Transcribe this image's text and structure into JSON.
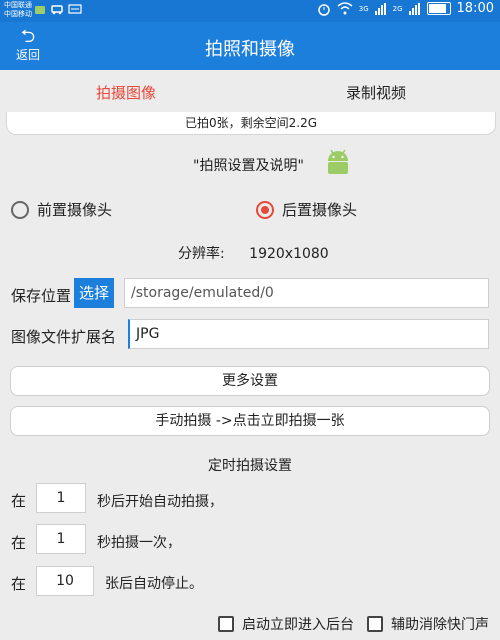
{
  "status_bar": {
    "carrier1": "中国联通",
    "carrier2": "中国移动",
    "time": "18:00",
    "network_labels": [
      "3G",
      "2G"
    ]
  },
  "app_bar": {
    "back_label": "返回",
    "title": "拍照和摄像"
  },
  "tabs": [
    {
      "label": "拍摄图像",
      "active": true
    },
    {
      "label": "录制视频",
      "active": false
    }
  ],
  "info": "已拍0张，剩余空间2.2G",
  "help_text": "\"拍照设置及说明\"",
  "camera": {
    "front_label": "前置摄像头",
    "rear_label": "后置摄像头",
    "selected": "rear"
  },
  "resolution": {
    "label": "分辨率:",
    "value": "1920x1080"
  },
  "save": {
    "label": "保存位置",
    "button": "选择",
    "path": "/storage/emulated/0"
  },
  "ext": {
    "label": "图像文件扩展名",
    "value": "JPG"
  },
  "buttons": {
    "more": "更多设置",
    "manual": "手动拍摄 ->点击立即拍摄一张"
  },
  "timer": {
    "title": "定时拍摄设置",
    "rows": [
      {
        "prefix": "在",
        "value": "1",
        "suffix": "秒后开始自动拍摄，"
      },
      {
        "prefix": "在",
        "value": "1",
        "suffix": "秒拍摄一次，"
      },
      {
        "prefix": "在",
        "value": "10",
        "suffix": "张后自动停止。"
      }
    ]
  },
  "checks": [
    {
      "label": "启动立即进入后台",
      "checked": false
    },
    {
      "label": "辅助消除快门声",
      "checked": false
    }
  ],
  "colors": {
    "primary": "#1d7fdc",
    "accent": "#e64a3b"
  }
}
